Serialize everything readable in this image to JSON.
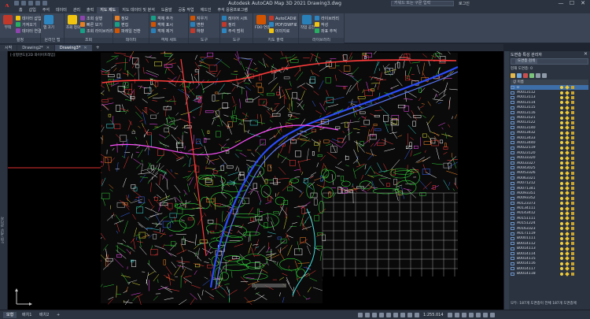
{
  "app": {
    "logo_letter": "A",
    "title": "Autodesk AutoCAD Map 3D 2021    Drawing3.dwg",
    "search_placeholder": "키워드 또는 구문 입력",
    "user": "로그인",
    "window_controls": [
      "—",
      "☐",
      "✕"
    ]
  },
  "ribbon_tabs": [
    "홈",
    "삽입",
    "주석",
    "데이터",
    "관리",
    "출력",
    "지도 제도",
    "지도 데이터 및 분석",
    "도움말",
    "공동 작업",
    "애드인",
    "주석 응용프로그램"
  ],
  "ribbon_active_tab": "지도 제도",
  "ribbon": {
    "panels": [
      {
        "title": "설정",
        "big": "부착",
        "rows": [
          "데이터 삽입",
          "가져오기",
          "데이터 연결"
        ]
      },
      {
        "title": "온라인 맵",
        "big": "맵 끄기",
        "rows": []
      },
      {
        "title": "조회",
        "big": "조회 정의",
        "rows": [
          "조회 실행",
          "빠른 보기",
          "조회 라이브러리"
        ]
      },
      {
        "title": "데이터",
        "big": "",
        "rows": [
          "정보",
          "편집",
          "파레일 전환"
        ]
      },
      {
        "title": "객체 세트",
        "big": "",
        "rows": [
          "객체 추가",
          "객체 표시",
          "객체 제거"
        ]
      },
      {
        "title": "도구",
        "big": "",
        "rows": [
          "지우기",
          "변환",
          "하향"
        ]
      },
      {
        "title": "도구",
        "big": "",
        "rows": [
          "레이어 시트",
          "정리",
          "주석 범위"
        ]
      },
      {
        "title": "지도 출력",
        "big": "FDO 연결",
        "rows": [
          "AutoCAD로",
          "PDF/DWF로",
          "이미지로"
        ]
      },
      {
        "title": "라이브러리",
        "big": "작업 공간",
        "rows": [
          "라이브러리",
          "작성",
          "좌표 추적"
        ]
      }
    ]
  },
  "doc_tabs": [
    {
      "label": "시작",
      "active": false
    },
    {
      "label": "Drawing2*",
      "active": false
    },
    {
      "label": "Drawing3*",
      "active": true
    }
  ],
  "left_strip_label": "도면 세부 관리자",
  "viewport_label": "[-][평면도][2D 와이어프레임]",
  "palette": {
    "title": "도면층 특성 관리자",
    "search_btn": "도면층 검색",
    "sub": "현재 도면층: 0",
    "col_header": "상 이름",
    "layers": [
      "0",
      "A0013112",
      "A0013113",
      "A0013114",
      "A0013115",
      "A0013116",
      "A0013121",
      "A0013122",
      "A0013140",
      "A0013432",
      "A0013433",
      "A0013440",
      "A0022119",
      "A0023120",
      "A0033320",
      "A0033327",
      "A0043025",
      "A0053326",
      "A0063321",
      "A0071212",
      "A0071341",
      "A0093351",
      "A0093352",
      "A0123373",
      "A0134111",
      "A0143412",
      "A0151111",
      "A0151224",
      "A0163323",
      "A0171119",
      "B0001111",
      "B0014112",
      "B0014113",
      "B0014114",
      "B0014115",
      "B0014116",
      "B0014117",
      "B0014118"
    ],
    "status": "모두: 187개 도면층이 전체 187개 도면층에"
  },
  "status_tabs": [
    {
      "label": "모형",
      "active": true
    },
    {
      "label": "배치1",
      "active": false
    },
    {
      "label": "배치2",
      "active": false
    },
    {
      "label": "+",
      "active": false
    }
  ],
  "status_scale": "1:255.014"
}
